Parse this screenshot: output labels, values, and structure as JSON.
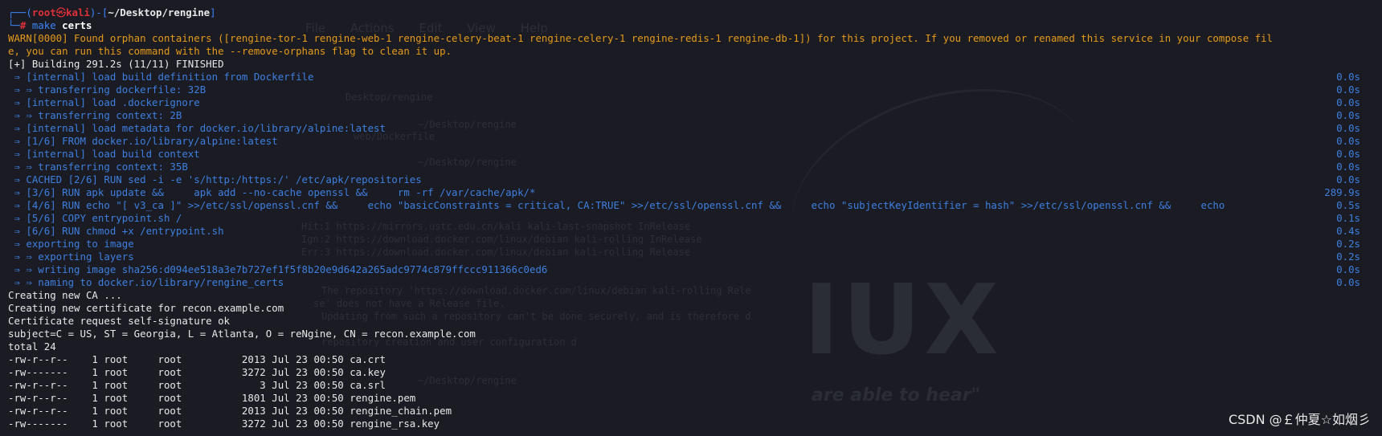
{
  "prompt": {
    "corner_top": "┌──(",
    "user": "root",
    "at": "㉿",
    "host": "kali",
    "mid": ")-[",
    "path": "~/Desktop/rengine",
    "close": "]",
    "corner_bottom": "└─",
    "hash": "# ",
    "command": "make",
    "argument": "certs"
  },
  "warn_lines": [
    "WARN[0000] Found orphan containers ([rengine-tor-1 rengine-web-1 rengine-celery-beat-1 rengine-celery-1 rengine-redis-1 rengine-db-1]) for this project. If you removed or renamed this service in your compose fil",
    "e, you can run this command with the --remove-orphans flag to clean it up."
  ],
  "building_line": "[+] Building 291.2s (11/11) FINISHED",
  "build_steps": [
    {
      "text": " ⇒ [internal] load build definition from Dockerfile",
      "time": "0.0s"
    },
    {
      "text": " ⇒ ⇒ transferring dockerfile: 32B",
      "time": "0.0s"
    },
    {
      "text": " ⇒ [internal] load .dockerignore",
      "time": "0.0s"
    },
    {
      "text": " ⇒ ⇒ transferring context: 2B",
      "time": "0.0s"
    },
    {
      "text": " ⇒ [internal] load metadata for docker.io/library/alpine:latest",
      "time": "0.0s"
    },
    {
      "text": " ⇒ [1/6] FROM docker.io/library/alpine:latest",
      "time": "0.0s"
    },
    {
      "text": " ⇒ [internal] load build context",
      "time": "0.0s"
    },
    {
      "text": " ⇒ ⇒ transferring context: 35B",
      "time": "0.0s"
    },
    {
      "text": " ⇒ CACHED [2/6] RUN sed -i -e 's/http:/https:/' /etc/apk/repositories",
      "time": "0.0s"
    },
    {
      "text": " ⇒ [3/6] RUN apk update &&     apk add --no-cache openssl &&     rm -rf /var/cache/apk/*",
      "time": "289.9s"
    },
    {
      "text": " ⇒ [4/6] RUN echo \"[ v3_ca ]\" >>/etc/ssl/openssl.cnf &&     echo \"basicConstraints = critical, CA:TRUE\" >>/etc/ssl/openssl.cnf &&     echo \"subjectKeyIdentifier = hash\" >>/etc/ssl/openssl.cnf &&     echo",
      "time": "0.5s"
    },
    {
      "text": " ⇒ [5/6] COPY entrypoint.sh /",
      "time": "0.1s"
    },
    {
      "text": " ⇒ [6/6] RUN chmod +x /entrypoint.sh",
      "time": "0.4s"
    },
    {
      "text": " ⇒ exporting to image",
      "time": "0.2s"
    },
    {
      "text": " ⇒ ⇒ exporting layers",
      "time": "0.2s"
    },
    {
      "text": " ⇒ ⇒ writing image sha256:d094ee518a3e7b727ef1f5f8b20e9d642a265adc9774c879ffccc911366c0ed6",
      "time": "0.0s"
    },
    {
      "text": " ⇒ ⇒ naming to docker.io/library/rengine_certs",
      "time": "0.0s"
    }
  ],
  "output_lines": [
    "Creating new CA ...",
    "Creating new certificate for recon.example.com",
    "Certificate request self-signature ok",
    "subject=C = US, ST = Georgia, L = Atlanta, O = reNgine, CN = recon.example.com",
    "total 24",
    "-rw-r--r--    1 root     root          2013 Jul 23 00:50 ca.crt",
    "-rw-------    1 root     root          3272 Jul 23 00:50 ca.key",
    "-rw-r--r--    1 root     root             3 Jul 23 00:50 ca.srl",
    "-rw-r--r--    1 root     root          1801 Jul 23 00:50 rengine.pem",
    "-rw-r--r--    1 root     root          2013 Jul 23 00:50 rengine_chain.pem",
    "-rw-------    1 root     root          3272 Jul 23 00:50 rengine_rsa.key"
  ],
  "watermark": "CSDN @￡仲夏☆如烟彡",
  "colors": {
    "background": "#1b1c23",
    "prompt_red": "#e0303a",
    "prompt_blue": "#3b83f6",
    "warn_orange": "#e59a1a",
    "build_blue": "#3d7fe0",
    "text": "#e8e8e8"
  }
}
